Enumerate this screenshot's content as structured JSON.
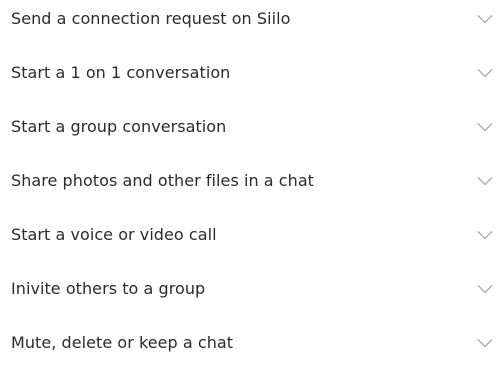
{
  "faq": {
    "items": [
      {
        "label": "Send a connection request on Siilo",
        "icon": "chevron-down-icon",
        "expanded": false
      },
      {
        "label": "Start a 1 on 1 conversation",
        "icon": "chevron-down-icon",
        "expanded": false
      },
      {
        "label": "Start a group conversation",
        "icon": "chevron-down-icon",
        "expanded": false
      },
      {
        "label": "Share photos and other files in a chat",
        "icon": "chevron-down-icon",
        "expanded": false
      },
      {
        "label": "Start a voice or video call",
        "icon": "chevron-down-icon",
        "expanded": false
      },
      {
        "label": "Inivite others to a group",
        "icon": "chevron-down-icon",
        "expanded": false
      },
      {
        "label": "Mute, delete or keep a chat",
        "icon": "chevron-down-icon",
        "expanded": false
      }
    ]
  },
  "colors": {
    "text": "#2b2b2b",
    "chevron": "#a9a9a9",
    "background": "#ffffff"
  }
}
